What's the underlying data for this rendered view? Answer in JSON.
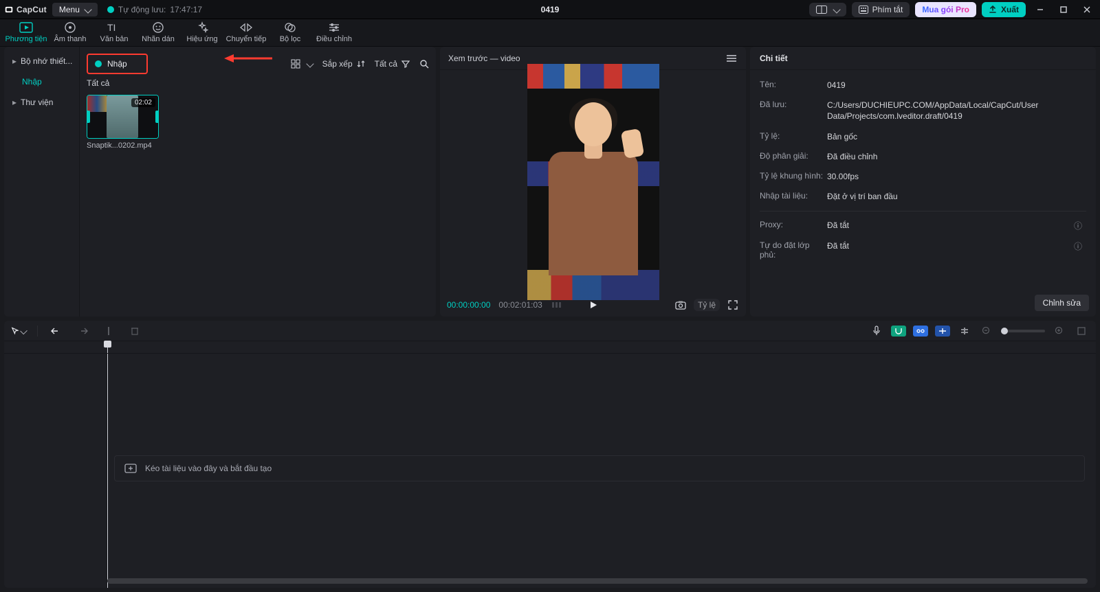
{
  "titlebar": {
    "app": "CapCut",
    "menu": "Menu",
    "autosave_prefix": "Tự động lưu:",
    "autosave_time": "17:47:17",
    "project": "0419",
    "layout": "",
    "shortcuts": "Phím tắt",
    "pro": "Mua gói Pro",
    "export": "Xuất"
  },
  "ribbon": {
    "items": [
      {
        "id": "media",
        "label": "Phương tiện"
      },
      {
        "id": "audio",
        "label": "Âm thanh"
      },
      {
        "id": "text",
        "label": "Văn bản"
      },
      {
        "id": "sticker",
        "label": "Nhãn dán"
      },
      {
        "id": "effect",
        "label": "Hiệu ứng"
      },
      {
        "id": "transition",
        "label": "Chuyển tiếp"
      },
      {
        "id": "filter",
        "label": "Bộ lọc"
      },
      {
        "id": "adjust",
        "label": "Điều chỉnh"
      }
    ]
  },
  "media": {
    "side": [
      {
        "id": "device",
        "label": "Bộ nhớ thiết..."
      },
      {
        "id": "import",
        "label": "Nhập"
      },
      {
        "id": "library",
        "label": "Thư viện"
      }
    ],
    "import_btn": "Nhập",
    "section": "Tất cả",
    "sort": "Sắp xếp",
    "filter_all": "Tất cả",
    "clip": {
      "dur": "02:02",
      "name": "Snaptik...0202.mp4"
    }
  },
  "preview": {
    "title": "Xem trước — video",
    "now": "00:00:00:00",
    "total": "00:02:01:03",
    "ratio": "Tỷ lệ"
  },
  "details": {
    "title": "Chi tiết",
    "rows": [
      {
        "k": "Tên:",
        "v": "0419"
      },
      {
        "k": "Đã lưu:",
        "v": "C:/Users/DUCHIEUPC.COM/AppData/Local/CapCut/User Data/Projects/com.lveditor.draft/0419"
      },
      {
        "k": "Tỷ lệ:",
        "v": "Bản gốc"
      },
      {
        "k": "Độ phân giải:",
        "v": "Đã điều chỉnh"
      },
      {
        "k": "Tỷ lệ khung hình:",
        "v": "30.00fps"
      },
      {
        "k": "Nhập tài liệu:",
        "v": "Đặt ở vị trí ban đầu"
      }
    ],
    "extra": [
      {
        "k": "Proxy:",
        "v": "Đã tắt"
      },
      {
        "k": "Tự do đặt lớp phủ:",
        "v": "Đã tắt"
      }
    ],
    "edit": "Chỉnh sửa"
  },
  "timeline": {
    "drop": "Kéo tài liệu vào đây và bắt đầu tạo"
  }
}
